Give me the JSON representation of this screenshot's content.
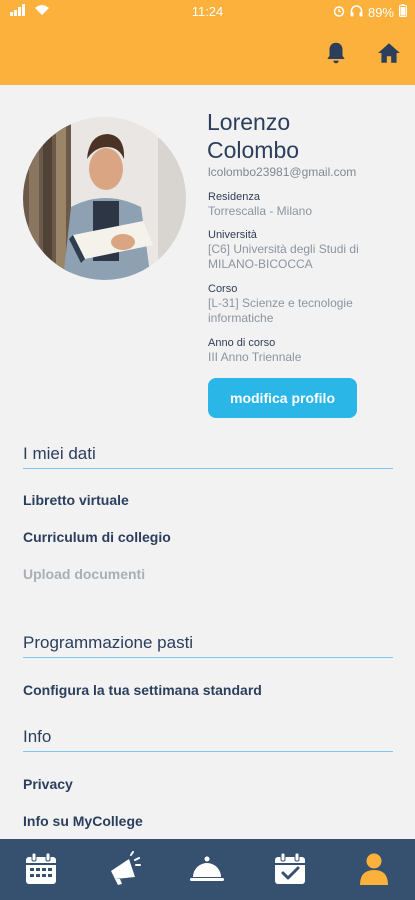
{
  "status_bar": {
    "time": "11:24",
    "battery": "89%"
  },
  "header": {
    "icons": [
      "bell-icon",
      "home-icon"
    ],
    "color": "#fbb13c"
  },
  "profile": {
    "name": "Lorenzo Colombo",
    "email": "lcolombo23981@gmail.com",
    "fields": [
      {
        "label": "Residenza",
        "value": "Torrescalla - Milano"
      },
      {
        "label": "Università",
        "value": "[C6] Università degli Studi di MILANO-BICOCCA"
      },
      {
        "label": "Corso",
        "value": "[L-31] Scienze e tecnologie informatiche"
      },
      {
        "label": "Anno di corso",
        "value": "III Anno Triennale"
      }
    ],
    "edit_button": "modifica profilo"
  },
  "sections": {
    "my_data": {
      "title": "I miei dati",
      "links": [
        "Libretto virtuale",
        "Curriculum di collegio",
        "Upload documenti"
      ]
    },
    "meals": {
      "title": "Programmazione pasti",
      "links": [
        "Configura la tua settimana standard"
      ]
    },
    "info": {
      "title": "Info",
      "links": [
        "Privacy",
        "Info su MyCollege"
      ]
    }
  },
  "tab_bar": {
    "tabs": [
      "calendar-icon",
      "megaphone-icon",
      "cloche-icon",
      "calendar-check-icon",
      "user-icon"
    ],
    "active_index": 4,
    "colors": {
      "background": "#35516f",
      "active": "#fbb13c",
      "inactive": "#ffffff"
    }
  }
}
